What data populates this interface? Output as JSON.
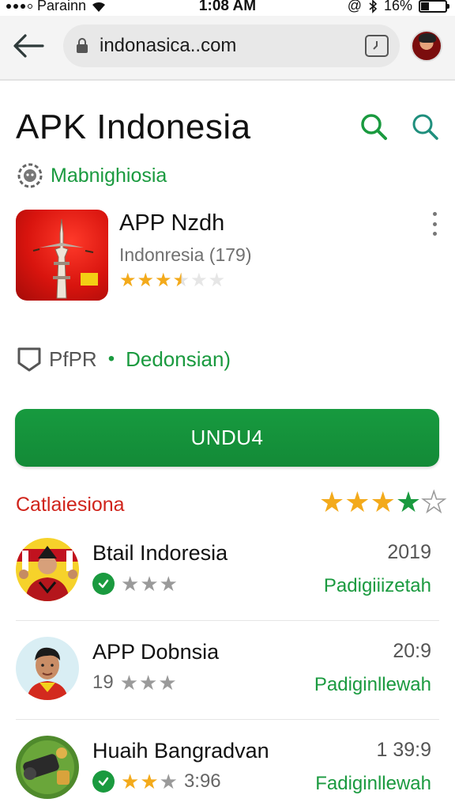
{
  "status_bar": {
    "carrier": "Parainn",
    "time": "1:08 AM",
    "battery": "16%"
  },
  "browser": {
    "url": "indonasica..com"
  },
  "header": {
    "title": "APK Indonesia",
    "developer": "Mabnighiosia"
  },
  "app": {
    "name": "APP Nzdh",
    "subtitle": "Indonresia (179)",
    "rating": 3.5
  },
  "meta": {
    "tag": "PfPR",
    "link": "Dedonsian)"
  },
  "install": {
    "label": "UNDU4"
  },
  "section": {
    "title": "Catlaiesiona",
    "rating": 3.5
  },
  "list": [
    {
      "name": "Btail Indoresia",
      "year": "2019",
      "prefix": "",
      "rating": 3,
      "tag": "Padigiiizetah"
    },
    {
      "name": "APP Dobnsia",
      "year": "20:9",
      "prefix": "19",
      "rating": 3,
      "tag": "Padiginllewah"
    },
    {
      "name": "Huaih Bangradvan",
      "year": "1 39:9",
      "prefix": "",
      "suffix": "3:96",
      "rating": 2.5,
      "tag": "Fadiginllewah"
    }
  ],
  "colors": {
    "accent": "#1a9a3f",
    "section_title": "#d0241b",
    "star": "#f3aa1b"
  }
}
